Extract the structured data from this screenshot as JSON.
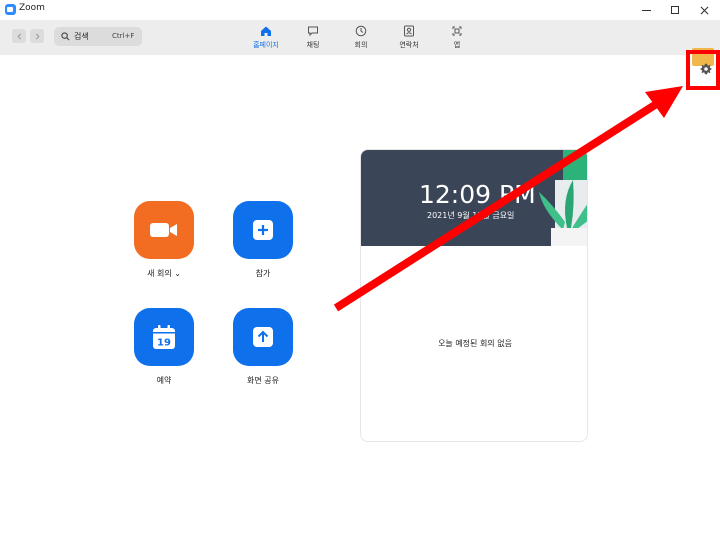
{
  "window": {
    "title": "Zoom"
  },
  "search": {
    "label": "검색",
    "shortcut": "Ctrl+F"
  },
  "tabs": [
    {
      "label": "홈페이지",
      "icon": "home-icon",
      "active": true
    },
    {
      "label": "채팅",
      "icon": "chat-icon",
      "active": false
    },
    {
      "label": "회의",
      "icon": "clock-icon",
      "active": false
    },
    {
      "label": "연락처",
      "icon": "contacts-icon",
      "active": false
    },
    {
      "label": "앱",
      "icon": "apps-icon",
      "active": false
    }
  ],
  "actions": {
    "new_meeting": {
      "label": "새 회의 ⌄",
      "icon": "video-camera-icon"
    },
    "join": {
      "label": "참가",
      "icon": "plus-icon"
    },
    "schedule": {
      "label": "예약",
      "icon": "calendar-icon",
      "calendar_day": "19"
    },
    "share_screen": {
      "label": "화면 공유",
      "icon": "share-arrow-up-icon"
    }
  },
  "card": {
    "time": "12:09 PM",
    "date": "2021년 9월 17일 금요일",
    "empty_message": "오늘 예정된 회의 없음"
  },
  "annotation": {
    "highlight": "settings-icon",
    "color": "#ff0000"
  },
  "colors": {
    "accent": "#0e71eb",
    "orange": "#f26d21",
    "card_header": "#3a4657"
  }
}
